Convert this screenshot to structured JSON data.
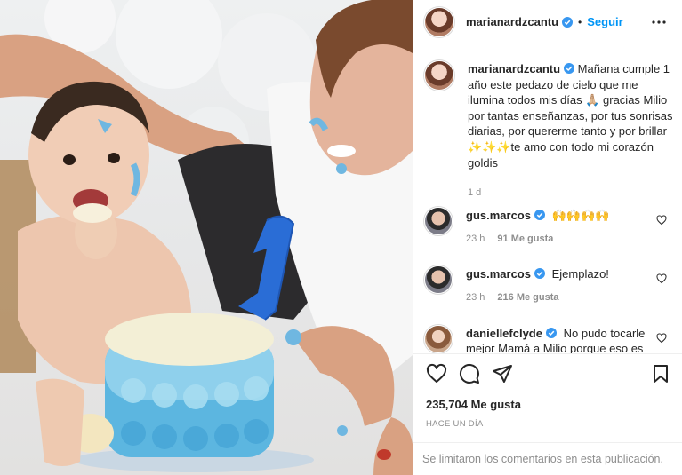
{
  "post": {
    "username": "marianardzcantu",
    "follow_label": "Seguir",
    "dot": "•",
    "caption_text": "Mañana cumple 1 año este pedazo de cielo que me ilumina todos mis días 🙏🏼 gracias Milio por tantas enseñanzas, por tus sonrisas diarias, por quererme tanto y por brillar ✨✨✨te amo con todo mi corazón goldis",
    "caption_time": "1 d",
    "likes": "235,704 Me gusta",
    "posted_ago": "HACE UN DÍA",
    "comments_limited": "Se limitaron los comentarios en esta publicación."
  },
  "comments": [
    {
      "username": "gus.marcos",
      "text": "🙌🙌🙌🙌",
      "time": "23 h",
      "likes": "91 Me gusta"
    },
    {
      "username": "gus.marcos",
      "text": "Ejemplazo!",
      "time": "23 h",
      "likes": "216 Me gusta"
    },
    {
      "username": "daniellefclyde",
      "text": "No pudo tocarle mejor Mamá a Milio porque eso es",
      "time": "",
      "likes": ""
    }
  ],
  "colors": {
    "accent": "#0095f6",
    "verified": "#3897f0",
    "muted": "#8e8e8e"
  },
  "icons": [
    "verified-badge-icon",
    "more-options-icon",
    "heart-icon",
    "comment-icon",
    "share-icon",
    "save-icon"
  ],
  "photo": {
    "cake_candle_number": "1"
  }
}
